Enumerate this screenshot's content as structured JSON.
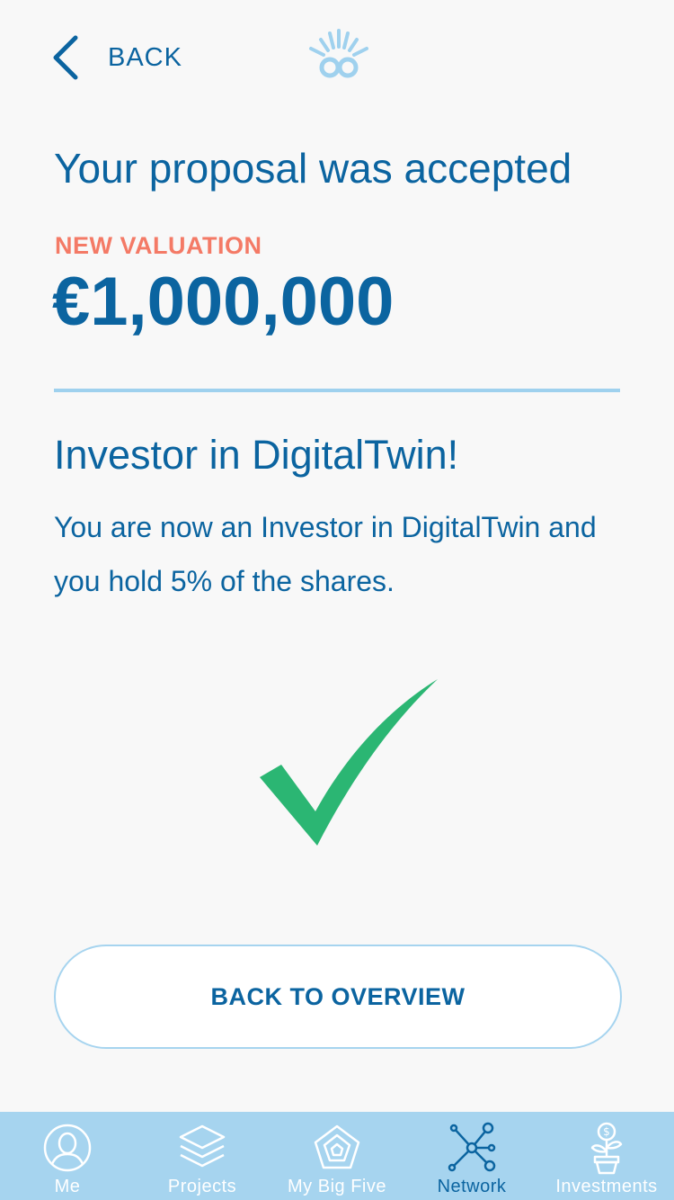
{
  "header": {
    "back_label": "BACK"
  },
  "main": {
    "title": "Your proposal was accepted",
    "eyebrow": "NEW VALUATION",
    "valuation": "€1,000,000",
    "subtitle": "Investor in DigitalTwin!",
    "body": "You are now an Investor in DigitalTwin and you hold 5% of the shares.",
    "button_label": "BACK TO OVERVIEW"
  },
  "tabbar": {
    "items": [
      {
        "label": "Me",
        "icon": "person-icon"
      },
      {
        "label": "Projects",
        "icon": "layers-icon"
      },
      {
        "label": "My Big Five",
        "icon": "pentagon-icon"
      },
      {
        "label": "Network",
        "icon": "network-icon"
      },
      {
        "label": "Investments",
        "icon": "money-plant-icon"
      }
    ],
    "active": "Network"
  },
  "colors": {
    "primary": "#0b64a0",
    "accent": "#f47a66",
    "success": "#2bb673",
    "tabbar_bg": "#a6d4ef",
    "divider": "#9fd1ee"
  }
}
